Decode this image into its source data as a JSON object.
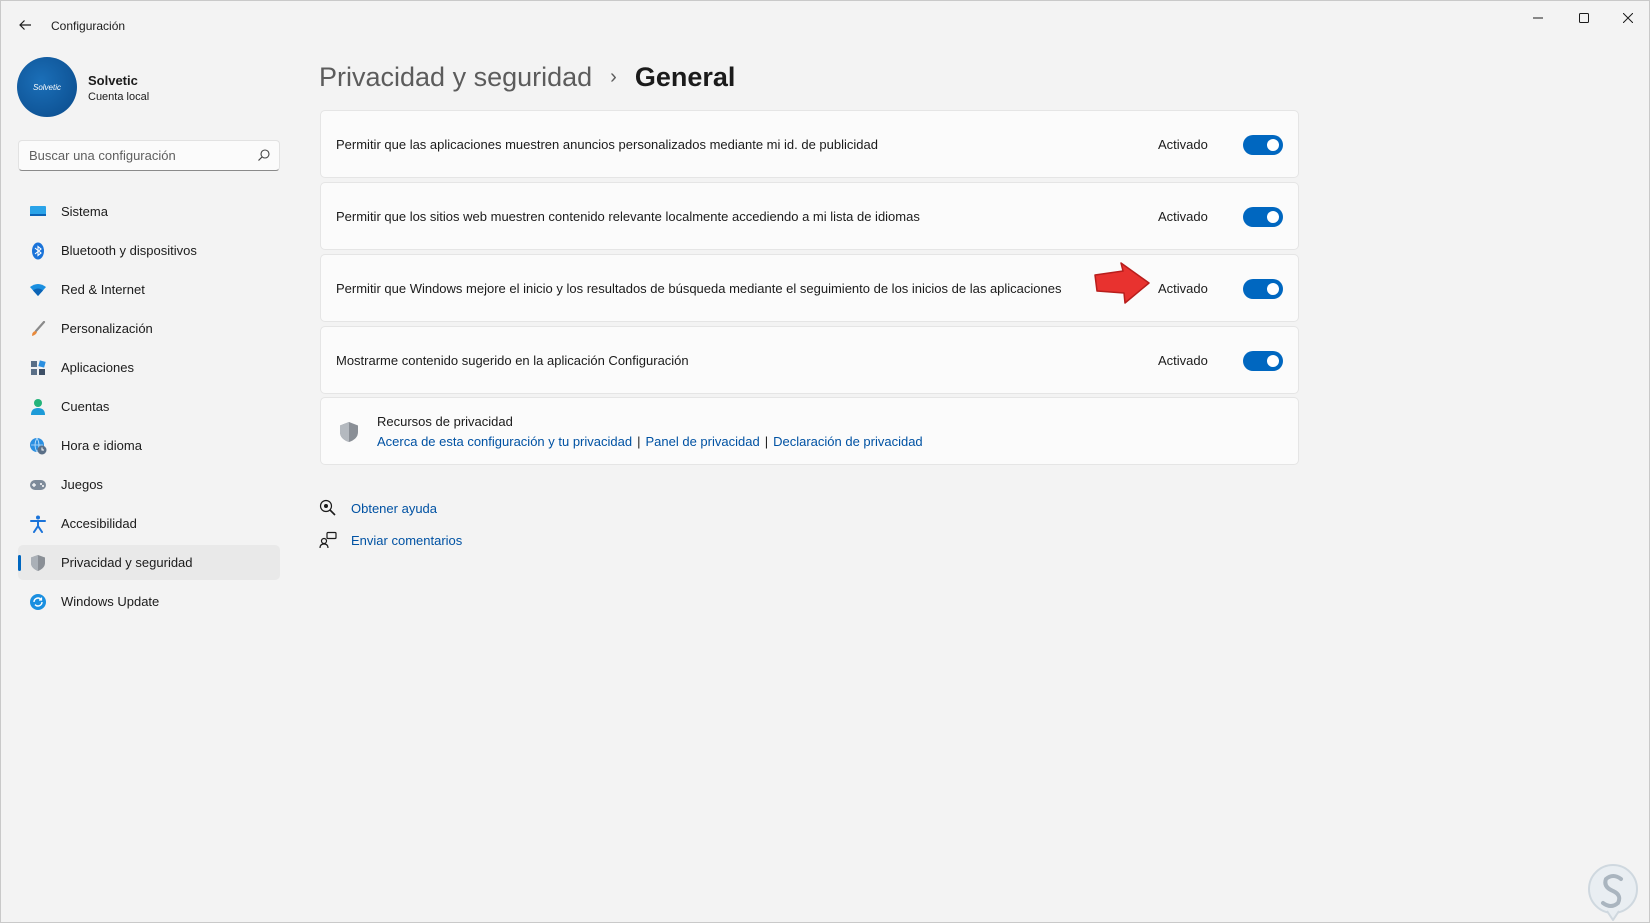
{
  "window": {
    "title": "Configuración",
    "controls": {
      "minimize": "minimize-icon",
      "maximize": "maximize-icon",
      "close": "close-icon"
    }
  },
  "profile": {
    "avatar_text": "Solvetic",
    "name": "Solvetic",
    "account": "Cuenta local"
  },
  "search": {
    "placeholder": "Buscar una configuración"
  },
  "sidebar": {
    "items": [
      {
        "label": "Sistema",
        "icon": "monitor-icon"
      },
      {
        "label": "Bluetooth y dispositivos",
        "icon": "bluetooth-icon"
      },
      {
        "label": "Red & Internet",
        "icon": "wifi-icon"
      },
      {
        "label": "Personalización",
        "icon": "brush-icon"
      },
      {
        "label": "Aplicaciones",
        "icon": "apps-icon"
      },
      {
        "label": "Cuentas",
        "icon": "person-icon"
      },
      {
        "label": "Hora e idioma",
        "icon": "globe-clock-icon"
      },
      {
        "label": "Juegos",
        "icon": "gamepad-icon"
      },
      {
        "label": "Accesibilidad",
        "icon": "accessibility-icon"
      },
      {
        "label": "Privacidad y seguridad",
        "icon": "shield-icon",
        "active": true
      },
      {
        "label": "Windows Update",
        "icon": "update-icon"
      }
    ]
  },
  "breadcrumb": {
    "parent": "Privacidad y seguridad",
    "separator": "›",
    "current": "General"
  },
  "settings": [
    {
      "text": "Permitir que las aplicaciones muestren anuncios personalizados mediante mi id. de publicidad",
      "state": "Activado",
      "on": true
    },
    {
      "text": "Permitir que los sitios web muestren contenido relevante localmente accediendo a mi lista de idiomas",
      "state": "Activado",
      "on": true
    },
    {
      "text": "Permitir que Windows mejore el inicio y los resultados de búsqueda mediante el seguimiento de los inicios de las aplicaciones",
      "state": "Activado",
      "on": true
    },
    {
      "text": "Mostrarme contenido sugerido en la aplicación Configuración",
      "state": "Activado",
      "on": true
    }
  ],
  "resources": {
    "title": "Recursos de privacidad",
    "links": [
      "Acerca de esta configuración y tu privacidad",
      "Panel de privacidad",
      "Declaración de privacidad"
    ],
    "separator": "|"
  },
  "help": {
    "get_help": "Obtener ayuda",
    "feedback": "Enviar comentarios"
  },
  "colors": {
    "accent": "#0067c0",
    "link": "#0052a3",
    "background": "#f3f3f3",
    "card": "#fbfbfb",
    "annotation_arrow": "#e8322f"
  }
}
